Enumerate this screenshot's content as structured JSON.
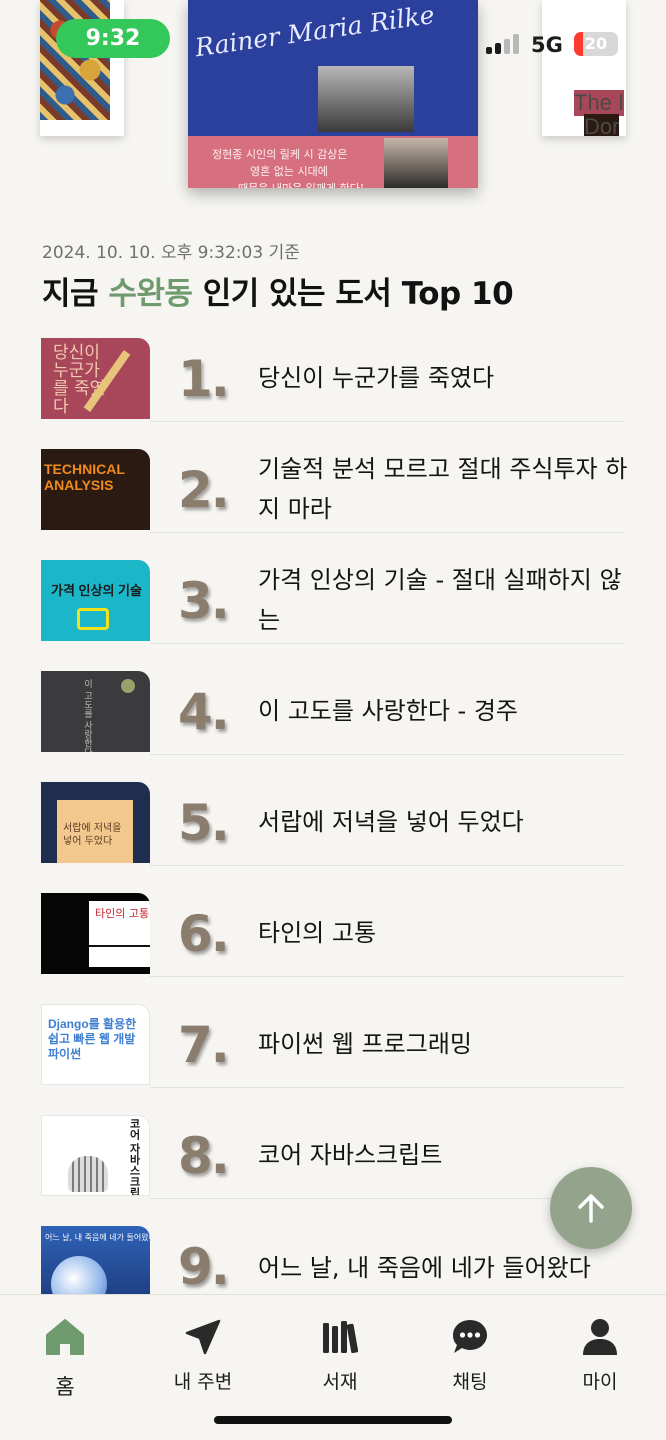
{
  "status_bar": {
    "time": "9:32",
    "network": "5G",
    "battery": "20",
    "battery_level": 0.2
  },
  "carousel": {
    "center_signature": "Rainer Maria Rilke",
    "center_line1": "정현종 시인의 릴케 시 감상은",
    "center_line2": "영혼 없는 시대에",
    "center_line3": "때묻은 내마음 일깨게 한다!",
    "right_line1": "The I",
    "right_line2": "Dor"
  },
  "header": {
    "timestamp": "2024. 10. 10. 오후 9:32:03 기준",
    "title_prefix": "지금 ",
    "title_highlight": "수완동",
    "title_suffix": " 인기 있는 도서 Top 10",
    "highlight_color": "#6f9a6e"
  },
  "books": [
    {
      "rank": "1.",
      "title": "당신이 누군가를 죽였다",
      "cover_text": "당신이 누군가를 죽였다"
    },
    {
      "rank": "2.",
      "title": "기술적 분석 모르고 절대 주식투자 하지 마라",
      "cover_text": "TECHNICAL ANALYSIS"
    },
    {
      "rank": "3.",
      "title": "가격 인상의 기술 - 절대 실패하지 않는",
      "cover_text": "가격 인상의 기술"
    },
    {
      "rank": "4.",
      "title": "이 고도를 사랑한다 - 경주",
      "cover_text": "이 고도를 사랑한다"
    },
    {
      "rank": "5.",
      "title": "서랍에 저녁을 넣어 두었다",
      "cover_text": "서랍에 저녁을 넣어 두었다"
    },
    {
      "rank": "6.",
      "title": "타인의 고통",
      "cover_text": "타인의 고통"
    },
    {
      "rank": "7.",
      "title": "파이썬 웹 프로그래밍",
      "cover_text": "Django를 활용한 쉽고 빠른 웹 개발 파이썬"
    },
    {
      "rank": "8.",
      "title": "코어 자바스크립트",
      "cover_text": "코어 자바스크립트"
    },
    {
      "rank": "9.",
      "title": "어느 날, 내 죽음에 네가 들어왔다",
      "cover_text": "어느 날, 내 죽음에 네가 들어왔다"
    }
  ],
  "nav": {
    "items": [
      {
        "label": "홈",
        "icon": "home-icon",
        "active": true
      },
      {
        "label": "내 주변",
        "icon": "location-arrow-icon"
      },
      {
        "label": "서재",
        "icon": "bookshelf-icon"
      },
      {
        "label": "채팅",
        "icon": "chat-bubble-icon"
      },
      {
        "label": "마이",
        "icon": "person-icon"
      }
    ],
    "active_color": "#6f9a6e"
  },
  "fab": {
    "icon": "arrow-up-icon"
  }
}
